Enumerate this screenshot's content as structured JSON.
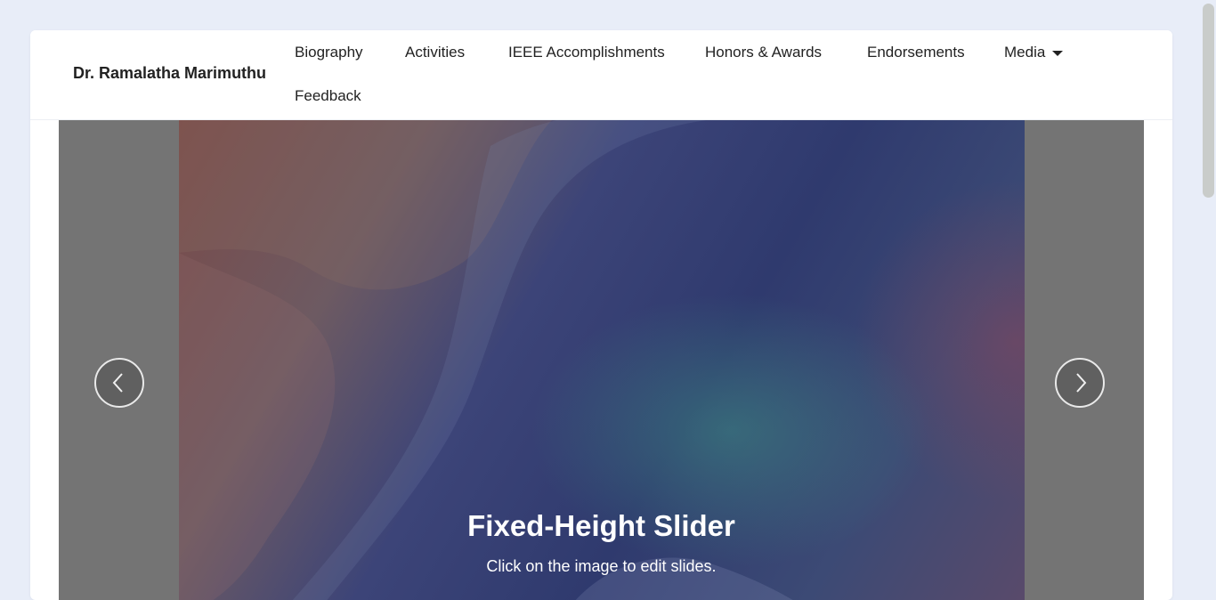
{
  "brand": {
    "name": "Dr. Ramalatha Marimuthu"
  },
  "nav": {
    "items": [
      {
        "label": "Biography"
      },
      {
        "label": "Activities"
      },
      {
        "label": "IEEE Accomplishments"
      },
      {
        "label": "Honors & Awards"
      },
      {
        "label": "Endorsements"
      },
      {
        "label": "Media",
        "has_dropdown": true
      },
      {
        "label": "Feedback"
      }
    ]
  },
  "slider": {
    "title": "Fixed-Height Slider",
    "subtitle": "Click on the image to edit slides.",
    "prev_icon": "chevron-left-icon",
    "next_icon": "chevron-right-icon"
  },
  "colors": {
    "page_bg": "#e8edf8",
    "card_bg": "#ffffff",
    "slider_bg": "#747474",
    "text_dark": "#222222"
  }
}
